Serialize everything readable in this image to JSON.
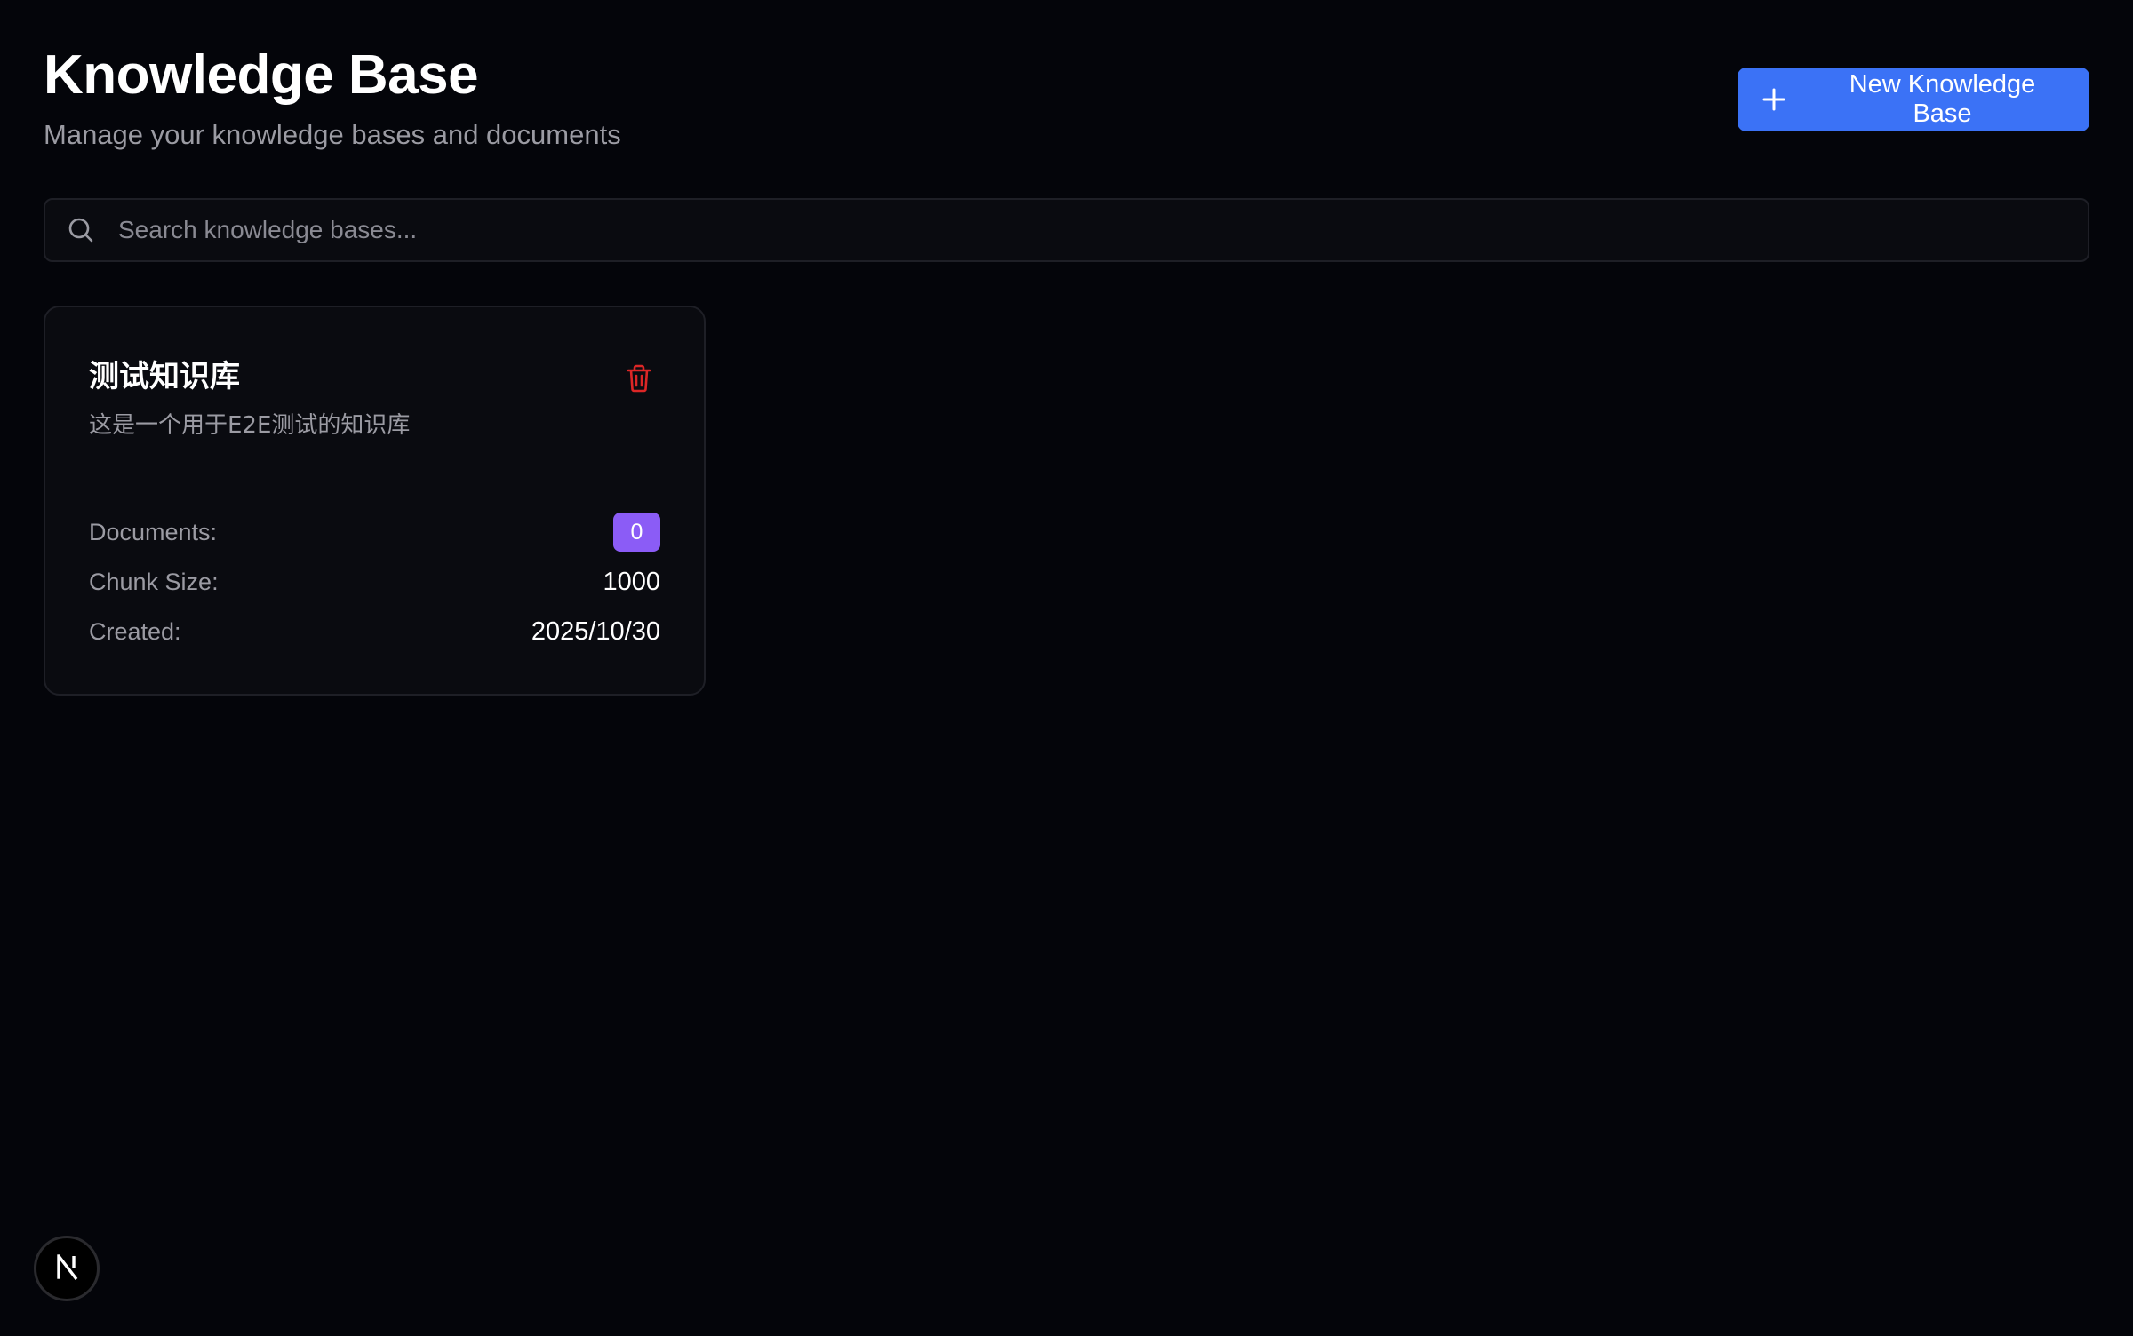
{
  "header": {
    "title": "Knowledge Base",
    "subtitle": "Manage your knowledge bases and documents",
    "new_button_label": "New Knowledge Base",
    "new_button_icon": "plus-icon"
  },
  "search": {
    "placeholder": "Search knowledge bases...",
    "value": "",
    "icon": "search-icon"
  },
  "knowledge_bases": [
    {
      "name": "测试知识库",
      "description": "这是一个用于E2E测试的知识库",
      "documents_label": "Documents:",
      "documents_count": "0",
      "chunk_size_label": "Chunk Size:",
      "chunk_size": "1000",
      "created_label": "Created:",
      "created": "2025/10/30",
      "delete_icon": "trash-icon"
    }
  ],
  "dev_badge": {
    "icon": "nextjs-logo-icon"
  },
  "colors": {
    "background": "#04050a",
    "card_background": "#0a0b10",
    "border": "#1e1f26",
    "primary_button": "#3b72f6",
    "badge": "#8b5cf6",
    "delete": "#dc2626",
    "muted_text": "#9b9ba3"
  }
}
